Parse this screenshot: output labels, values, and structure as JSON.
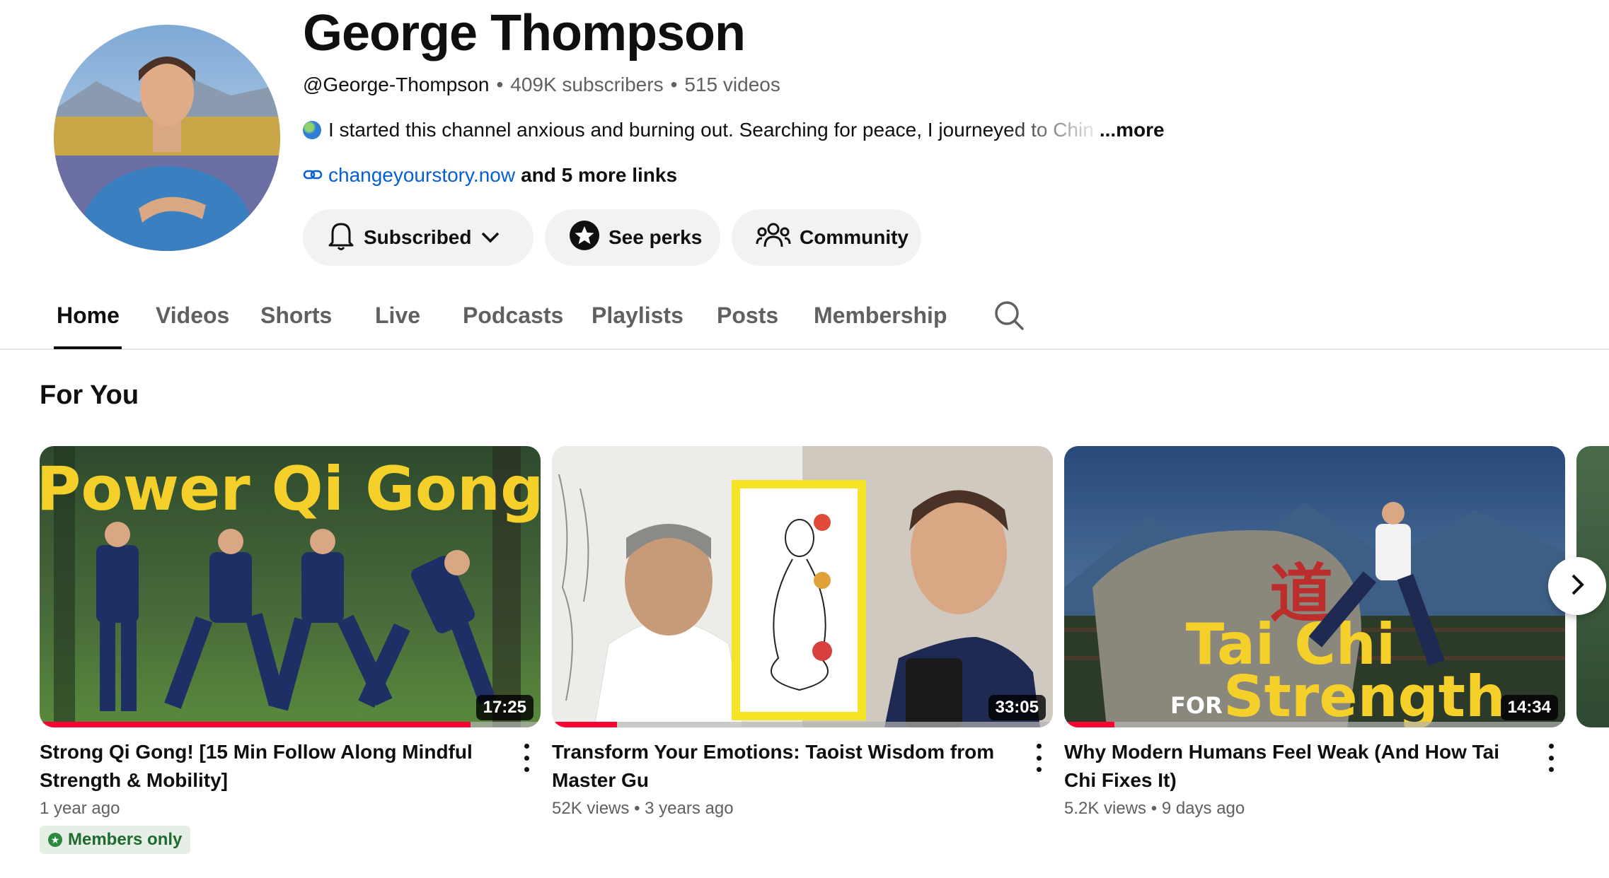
{
  "channel": {
    "name": "George Thompson",
    "handle": "@George-Thompson",
    "subscribers": "409K subscribers",
    "videos": "515 videos",
    "description": "I started this channel anxious and burning out. Searching for peace, I journeyed to Chin",
    "more_label": "...more",
    "link_url": "changeyourstory.now",
    "link_more": "and 5 more links"
  },
  "buttons": {
    "subscribed": "Subscribed",
    "perks": "See perks",
    "community": "Community"
  },
  "tabs": [
    {
      "label": "Home",
      "active": true
    },
    {
      "label": "Videos"
    },
    {
      "label": "Shorts"
    },
    {
      "label": "Live"
    },
    {
      "label": "Podcasts"
    },
    {
      "label": "Playlists"
    },
    {
      "label": "Posts"
    },
    {
      "label": "Membership"
    }
  ],
  "section": {
    "title": "For You"
  },
  "videos": [
    {
      "title": "Strong Qi Gong! [15 Min Follow Along Mindful Strength & Mobility]",
      "thumb_text": "Power Qi Gong",
      "duration": "17:25",
      "meta": "1 year ago",
      "badge": "Members only",
      "progress": 0.86
    },
    {
      "title": "Transform Your Emotions: Taoist Wisdom from Master Gu",
      "duration": "33:05",
      "views": "52K views",
      "age": "3 years ago",
      "progress": 0.13
    },
    {
      "title": "Why Modern Humans Feel Weak (And How Tai Chi Fixes It)",
      "thumb_text_top": "Tai Chi",
      "thumb_text_for": "FOR",
      "thumb_text_bottom": "Strength",
      "duration": "14:34",
      "views": "5.2K views",
      "age": "9 days ago",
      "progress": 0.1
    }
  ],
  "colors": {
    "accent_red": "#ff0033",
    "link_blue": "#065fd4",
    "member_green": "#1f6b2f"
  }
}
